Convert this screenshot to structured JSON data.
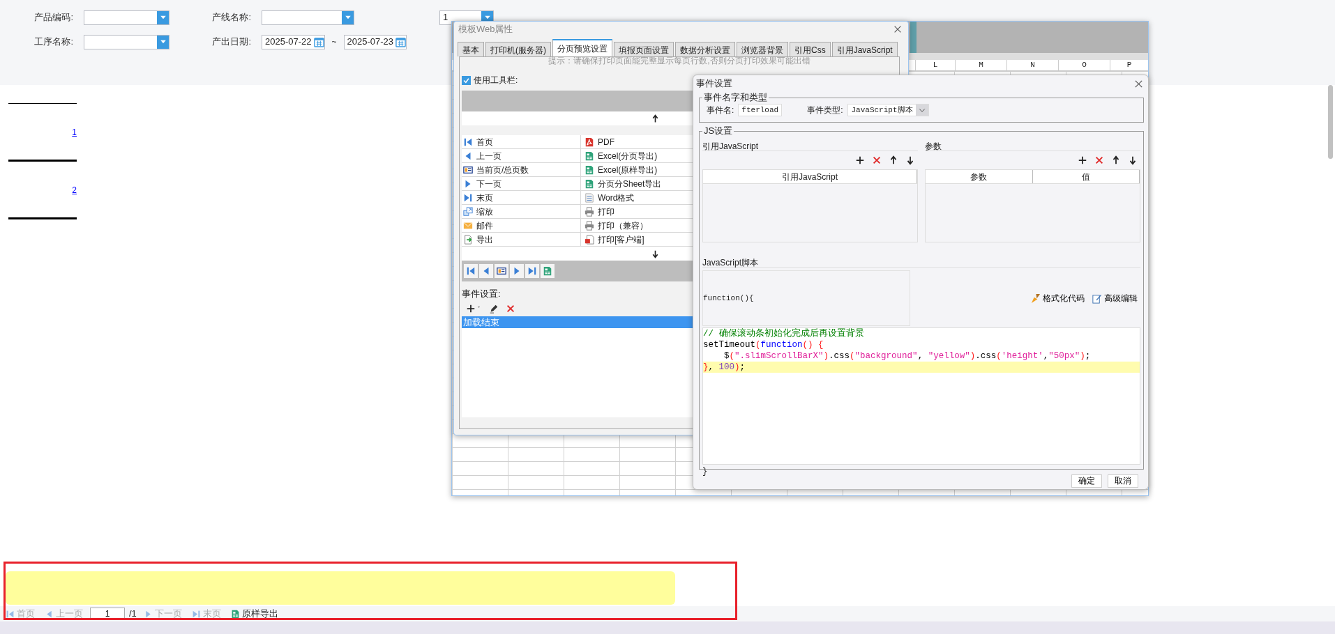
{
  "filters": {
    "row_1": [
      {
        "kind": "select",
        "label": "产品编码:"
      },
      {
        "kind": "select",
        "label": "产线名称:"
      },
      {
        "kind": "select",
        "value": "1"
      }
    ],
    "row_2": [
      {
        "kind": "select",
        "label": "工序名称:"
      },
      {
        "kind": "date_range",
        "label": "产出日期:",
        "from": "2025-07-22",
        "separator": "~",
        "to": "2025-07-23"
      }
    ]
  },
  "report_pages": [
    {
      "number": "1"
    },
    {
      "number": "2"
    }
  ],
  "designer": {
    "columns": [
      "L",
      "M",
      "N",
      "O",
      "P"
    ]
  },
  "web_dialog": {
    "title": "模板Web属性",
    "tabs": [
      {
        "label": "基本",
        "selected": false
      },
      {
        "label": "打印机(服务器)",
        "selected": false
      },
      {
        "label": "分页预览设置",
        "selected": true
      },
      {
        "label": "填报页面设置",
        "selected": false
      },
      {
        "label": "数据分析设置",
        "selected": false
      },
      {
        "label": "浏览器背景",
        "selected": false
      },
      {
        "label": "引用Css",
        "selected": false
      },
      {
        "label": "引用JavaScript",
        "selected": false
      }
    ],
    "hint": "提示：请确保打印页面能完整显示每页行数,否则分页打印效果可能出错",
    "use_toolbar": {
      "label": "使用工具栏:",
      "checked": true
    },
    "left_items": [
      {
        "kind": "first",
        "label": "首页"
      },
      {
        "kind": "prev",
        "label": "上一页"
      },
      {
        "kind": "pageinfo",
        "label": "当前页/总页数"
      },
      {
        "kind": "next",
        "label": "下一页"
      },
      {
        "kind": "last",
        "label": "末页"
      },
      {
        "kind": "zoom",
        "label": "缩放"
      },
      {
        "kind": "mail",
        "label": "邮件"
      },
      {
        "kind": "export",
        "label": "导出"
      }
    ],
    "right_items": [
      {
        "kind": "pdf",
        "label": "PDF"
      },
      {
        "kind": "excel",
        "label": "Excel(分页导出)"
      },
      {
        "kind": "excel",
        "label": "Excel(原样导出)"
      },
      {
        "kind": "excel",
        "label": "分页分Sheet导出"
      },
      {
        "kind": "word",
        "label": "Word格式"
      },
      {
        "kind": "print",
        "label": "打印"
      },
      {
        "kind": "print",
        "label": "打印（兼容）"
      },
      {
        "kind": "clientprint",
        "label": "打印[客户端]"
      }
    ],
    "events_label": "事件设置:",
    "events": [
      {
        "label": "加载结束",
        "selected": true
      }
    ]
  },
  "event_dialog": {
    "title": "事件设置",
    "name_type_legend": "事件名字和类型",
    "name_label": "事件名:",
    "name_value": "fterload",
    "type_label": "事件类型:",
    "type_value": "JavaScript脚本",
    "js_legend": "JS设置",
    "ref_title": "引用JavaScript",
    "ref_columns": [
      "引用JavaScript"
    ],
    "param_title": "参数",
    "param_columns": [
      "参数",
      "值"
    ],
    "script_title": "JavaScript脚本",
    "function_head": "function(){",
    "actions": [
      {
        "kind": "brush",
        "label": "格式化代码"
      },
      {
        "kind": "editdoc",
        "label": "高级编辑"
      }
    ],
    "code_lines": [
      {
        "highlighted": false,
        "tokens": [
          {
            "kind": "comment",
            "text": "// 确保滚动条初始化完成后再设置背景"
          }
        ]
      },
      {
        "highlighted": false,
        "tokens": [
          {
            "kind": "plain",
            "text": "setTimeout"
          },
          {
            "kind": "paren",
            "text": "("
          },
          {
            "kind": "keyword",
            "text": "function"
          },
          {
            "kind": "paren",
            "text": "() {"
          }
        ]
      },
      {
        "highlighted": false,
        "tokens": [
          {
            "kind": "plain",
            "text": "    $"
          },
          {
            "kind": "paren",
            "text": "("
          },
          {
            "kind": "string",
            "text": "\".slimScrollBarX\""
          },
          {
            "kind": "paren",
            "text": ")"
          },
          {
            "kind": "plain",
            "text": ".css"
          },
          {
            "kind": "paren",
            "text": "("
          },
          {
            "kind": "string",
            "text": "\"background\""
          },
          {
            "kind": "plain",
            "text": ", "
          },
          {
            "kind": "string",
            "text": "\"yellow\""
          },
          {
            "kind": "paren",
            "text": ")"
          },
          {
            "kind": "plain",
            "text": ".css"
          },
          {
            "kind": "paren",
            "text": "("
          },
          {
            "kind": "string",
            "text": "'height'"
          },
          {
            "kind": "plain",
            "text": ","
          },
          {
            "kind": "string",
            "text": "\"50px\""
          },
          {
            "kind": "paren",
            "text": ")"
          },
          {
            "kind": "plain",
            "text": ";"
          }
        ]
      },
      {
        "highlighted": true,
        "tokens": [
          {
            "kind": "paren",
            "text": "}"
          },
          {
            "kind": "plain",
            "text": ", "
          },
          {
            "kind": "number",
            "text": "100"
          },
          {
            "kind": "paren",
            "text": ")"
          },
          {
            "kind": "plain",
            "text": ";"
          }
        ]
      }
    ],
    "function_tail": "}",
    "buttons": [
      "确定",
      "取消"
    ]
  },
  "bottom_toolbar": [
    {
      "kind": "first",
      "label": "首页",
      "disabled": true
    },
    {
      "kind": "prev",
      "label": "上一页",
      "disabled": true
    },
    {
      "kind": "page_input",
      "value": "1"
    },
    {
      "kind": "page_total",
      "label": "/1"
    },
    {
      "kind": "next",
      "label": "下一页",
      "disabled": true
    },
    {
      "kind": "last",
      "label": "末页",
      "disabled": true
    },
    {
      "kind": "excel",
      "label": "原样导出",
      "disabled": false
    }
  ]
}
